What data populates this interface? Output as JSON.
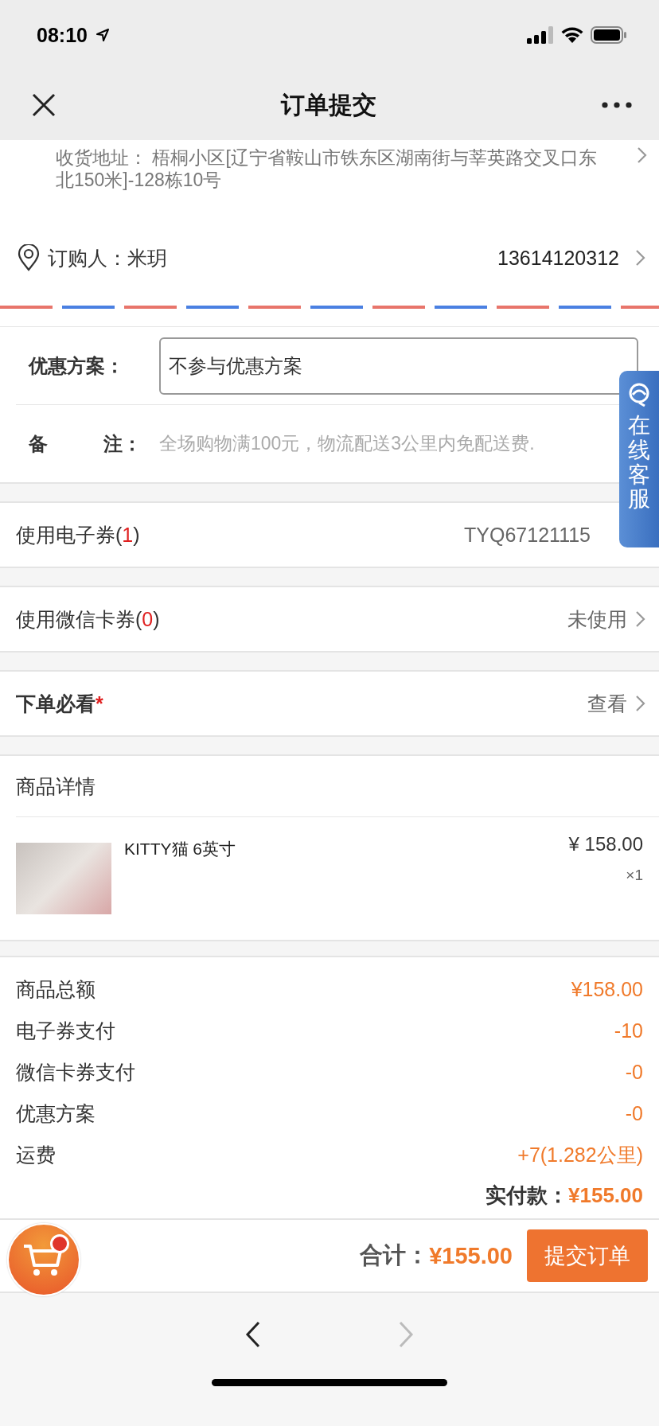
{
  "status_bar": {
    "time": "08:10"
  },
  "nav": {
    "title": "订单提交"
  },
  "address": {
    "label": "收货地址：",
    "value": "梧桐小区[辽宁省鞍山市铁东区湖南街与莘英路交叉口东北150米]-128栋10号"
  },
  "buyer": {
    "label": "订购人：",
    "name": "米玥",
    "phone": "13614120312"
  },
  "discount": {
    "label": "优惠方案：",
    "value": "不参与优惠方案"
  },
  "remark": {
    "label_start": "备",
    "label_end": "注：",
    "placeholder": "全场购物满100元，物流配送3公里内免配送费."
  },
  "options": [
    {
      "kind": "count",
      "label": "使用电子券(",
      "count": "1",
      "close": ")",
      "value": "TYQ67121115"
    },
    {
      "kind": "count",
      "label": "使用微信卡券(",
      "count": "0",
      "close": ")",
      "value": "未使用"
    },
    {
      "kind": "required",
      "label": "下单必看",
      "mark": "*",
      "value": "查看"
    }
  ],
  "products": {
    "header": "商品详情",
    "items": [
      {
        "name": "KITTY猫 6英寸",
        "price": "¥ 158.00",
        "qty": "×1"
      }
    ]
  },
  "summary": [
    {
      "label": "商品总额",
      "value": "¥158.00"
    },
    {
      "label": "电子券支付",
      "value": "-10"
    },
    {
      "label": "微信卡券支付",
      "value": "-0"
    },
    {
      "label": "优惠方案",
      "value": "-0"
    },
    {
      "label": "运费",
      "value": "+7(1.282公里)"
    }
  ],
  "paid": {
    "label": "实付款：",
    "value": "¥155.00"
  },
  "footer": {
    "label": "合计：",
    "value": "¥155.00",
    "button": "提交订单"
  },
  "service_tab": {
    "text": "在线客服"
  },
  "browser_nav": {
    "back": {
      "disabled": false
    },
    "forward": {
      "disabled": true
    }
  }
}
